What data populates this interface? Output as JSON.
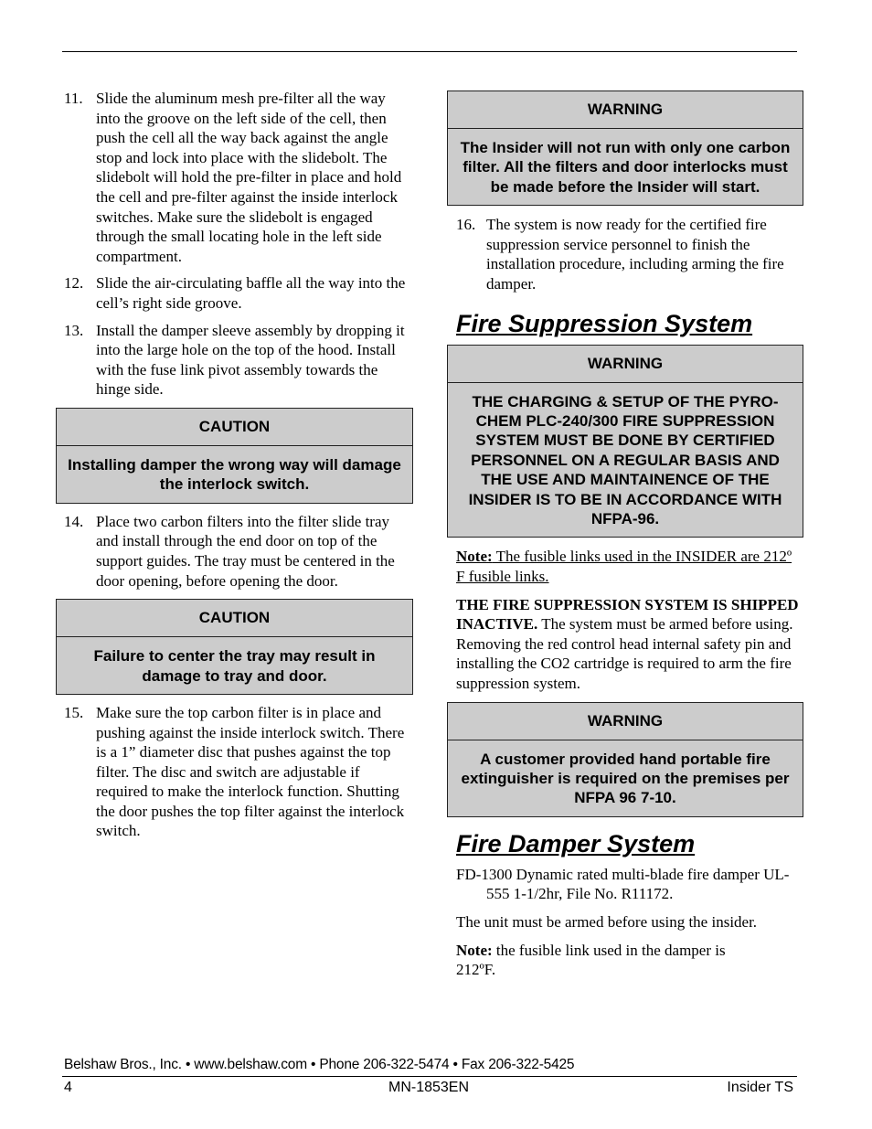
{
  "left_column": {
    "step11": {
      "number": "11.",
      "text": "Slide the aluminum mesh pre-filter all the way into the groove on the left side of the cell, then push the cell all the way back against the angle stop and lock into place with the slidebolt.  The slidebolt will hold the pre-filter in place and hold the cell and pre-filter against the inside interlock switches.  Make sure the slidebolt is engaged through the small locating hole in the left side compartment."
    },
    "step12": {
      "number": "12.",
      "text": "Slide the air-circulating baffle all the way into the cell’s right side groove."
    },
    "step13": {
      "number": "13.",
      "text": "Install the damper sleeve assembly by dropping it into the large hole on the top of the hood. Install with the fuse link pivot assembly towards the hinge side."
    },
    "caution1": {
      "title": "CAUTION",
      "body": "Installing damper the wrong way will damage the interlock switch."
    },
    "step14": {
      "number": "14.",
      "text": "Place two carbon filters into the filter slide tray and install through the end door on top of the support guides.  The tray must be centered in the door opening, before opening the door."
    },
    "caution2": {
      "title": "CAUTION",
      "body": "Failure to center the tray may result in damage to tray and door."
    },
    "step15": {
      "number": "15.",
      "text": "Make sure the top carbon filter is in place and pushing against the inside interlock switch.  There is a 1” diameter disc that pushes against the top filter.  The disc and switch are adjustable if required to make the interlock function.  Shutting the door pushes the top filter against the interlock switch."
    }
  },
  "right_column": {
    "warning1": {
      "title": "WARNING",
      "body": "The Insider will not run with only one carbon filter.  All the filters and door interlocks must be made before the Insider will start."
    },
    "step16": {
      "number": "16.",
      "text": "The system is now ready for the certified fire suppression service personnel to finish the installation procedure, including arming the fire damper."
    },
    "fire_suppression": {
      "heading": "Fire Suppression System",
      "warning": {
        "title": "WARNING",
        "body": "THE CHARGING & SETUP OF THE PYRO-CHEM PLC-240/300 FIRE SUPPRESSION SYSTEM MUST BE DONE BY CERTIFIED PERSONNEL ON A REGULAR BASIS AND THE USE AND MAINTAINENCE OF THE INSIDER IS TO BE IN ACCORDANCE WITH NFPA-96."
      },
      "note_label": "Note:",
      "note_text": " The fusible links used in the INSIDER are 212º F fusible links.",
      "inactive_bold": "THE FIRE SUPPRESSION SYSTEM IS SHIPPED INACTIVE.",
      "inactive_text": "  The system must be armed before using.  Removing the red control head internal safety pin and installing the CO2 cartridge is required to arm the fire suppression system.",
      "warning2": {
        "title": "WARNING",
        "body": "A customer provided hand portable fire extinguisher is required on the premises per NFPA 96 7-10."
      }
    },
    "fire_damper": {
      "heading": "Fire Damper System",
      "spec": "FD-1300 Dynamic rated multi-blade fire damper UL-555 1-1/2hr, File No. R11172.",
      "armed": "The unit must be armed before using the insider.",
      "note_label": "Note:",
      "note_text": " the fusible link used in the damper is 212ºF."
    }
  },
  "footer": {
    "contact": "Belshaw Bros., Inc. • www.belshaw.com • Phone 206-322-5474 • Fax 206-322-5425",
    "page_number": "4",
    "doc_number": "MN-1853EN",
    "product": "Insider TS"
  }
}
